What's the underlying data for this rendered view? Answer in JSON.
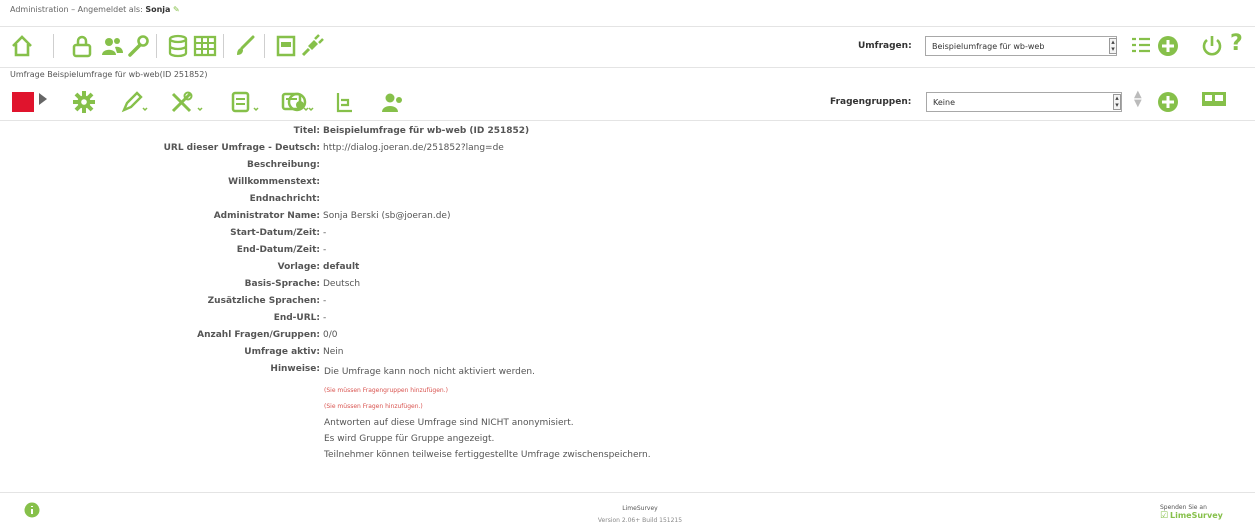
{
  "colors": {
    "green": "#86c04a",
    "red": "#e0142d",
    "error": "#d9534f",
    "grey": "#666666"
  },
  "header": {
    "admin_label": "Administration",
    "logged_in_text": "– Angemeldet als:",
    "user_name": "Sonja"
  },
  "main_toolbar": {
    "icons": [
      "home-icon",
      "lock-icon",
      "users-icon",
      "wrench-icon",
      "database-icon",
      "table-icon",
      "brush-icon",
      "export-icon",
      "plugin-icon"
    ],
    "survey_label": "Umfragen:",
    "survey_selected": "Beispielumfrage für wb-web",
    "right_icons": [
      "list-icon",
      "add-icon",
      "power-icon",
      "help-icon"
    ]
  },
  "survey_bar": {
    "title": "Umfrage Beispielumfrage für wb-web(ID 251852)",
    "icons": [
      "stop-icon",
      "play-arrow-icon",
      "gear-icon",
      "pencil-icon",
      "tools-icon",
      "survey-tools-icon",
      "display-icon",
      "responses-icon",
      "analyze-icon",
      "tokens-icon"
    ],
    "group_label": "Fragengruppen:",
    "group_selected": "Keine",
    "right_icons": [
      "add-group-icon",
      "layout-icon"
    ]
  },
  "info": {
    "title_label": "Titel:",
    "title_value": "Beispielumfrage für wb-web (ID 251852)",
    "url_label": "URL dieser Umfrage - Deutsch:",
    "url_value": "http://dialog.joeran.de/251852?lang=de",
    "desc_label": "Beschreibung:",
    "desc_value": "",
    "welcome_label": "Willkommenstext:",
    "welcome_value": "",
    "end_msg_label": "Endnachricht:",
    "end_msg_value": "",
    "admin_label": "Administrator Name:",
    "admin_value": "Sonja Berski (sb@joeran.de)",
    "start_label": "Start-Datum/Zeit:",
    "start_value": "-",
    "end_label": "End-Datum/Zeit:",
    "end_value": "-",
    "template_label": "Vorlage:",
    "template_value": "default",
    "lang_label": "Basis-Sprache:",
    "lang_value": "Deutsch",
    "addlang_label": "Zusätzliche Sprachen:",
    "addlang_value": "-",
    "endurl_label": "End-URL:",
    "endurl_value": "-",
    "count_label": "Anzahl Fragen/Gruppen:",
    "count_value": "0/0",
    "active_label": "Umfrage aktiv:",
    "active_value": "Nein",
    "notes_label": "Hinweise:",
    "notes": {
      "cannot_activate": "Die Umfrage kann noch nicht aktiviert werden.",
      "err_groups": "(Sie müssen Fragengruppen hinzufügen.)",
      "err_questions": "(Sie müssen Fragen hinzufügen.)",
      "anonym": "Antworten auf diese Umfrage sind NICHT anonymisiert.",
      "group_by_group": "Es wird Gruppe für Gruppe angezeigt.",
      "save_partial": "Teilnehmer können teilweise fertiggestellte Umfrage zwischenspeichern."
    }
  },
  "footer": {
    "app_name": "LimeSurvey",
    "version": "Version 2.06+ Build 151215",
    "donate": "Spenden Sie an",
    "brand": "LimeSurvey"
  }
}
